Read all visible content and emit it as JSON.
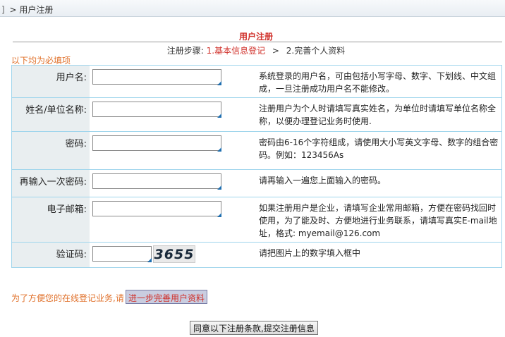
{
  "breadcrumb": {
    "home_glyph": "]",
    "separator": ">",
    "current": "用户注册"
  },
  "section": {
    "title": "用户注册"
  },
  "steps": {
    "prefix": "注册步骤:",
    "step1": "1.基本信息登记",
    "arrow": ">",
    "step2": "2.完善个人资料"
  },
  "required_note": "以下均为必填项",
  "form": {
    "rows": [
      {
        "label": "用户名:",
        "value": "",
        "hint": "系统登录的用户名，可由包括小写字母、数字、下划线、中文组成，一旦注册成功用户名不能修改。"
      },
      {
        "label": "姓名/单位名称:",
        "value": "",
        "hint": "注册用户为个人时请填写真实姓名，为单位时请填写单位名称全称，以便办理登记业务时使用."
      },
      {
        "label": "密码:",
        "value": "",
        "hint": "密码由6-16个字符组成，请使用大小写英文字母、数字的组合密码。例如：123456As"
      },
      {
        "label": "再输入一次密码:",
        "value": "",
        "hint": "请再输入一遍您上面输入的密码。"
      },
      {
        "label": "电子邮箱:",
        "value": "",
        "hint": "如果注册用户是企业，请填写企业常用邮箱，方便在密码找回时使用，为了能及时、方便地进行业务联系，请填写真实E-mail地址，格式: myemail@126.com"
      },
      {
        "label": "验证码:",
        "value": "",
        "hint": "请把图片上的数字填入框中",
        "captcha": "3655"
      }
    ]
  },
  "more": {
    "note": "为了方便您的在线登记业务,请",
    "link": "进一步完善用户资料"
  },
  "submit_label": "同意以下注册条款,提交注册信息",
  "colors": {
    "accent_red": "#d0302a",
    "note_orange": "#e0702a",
    "border_blue": "#9fd5ec",
    "label_bg": "#e9eef0"
  }
}
